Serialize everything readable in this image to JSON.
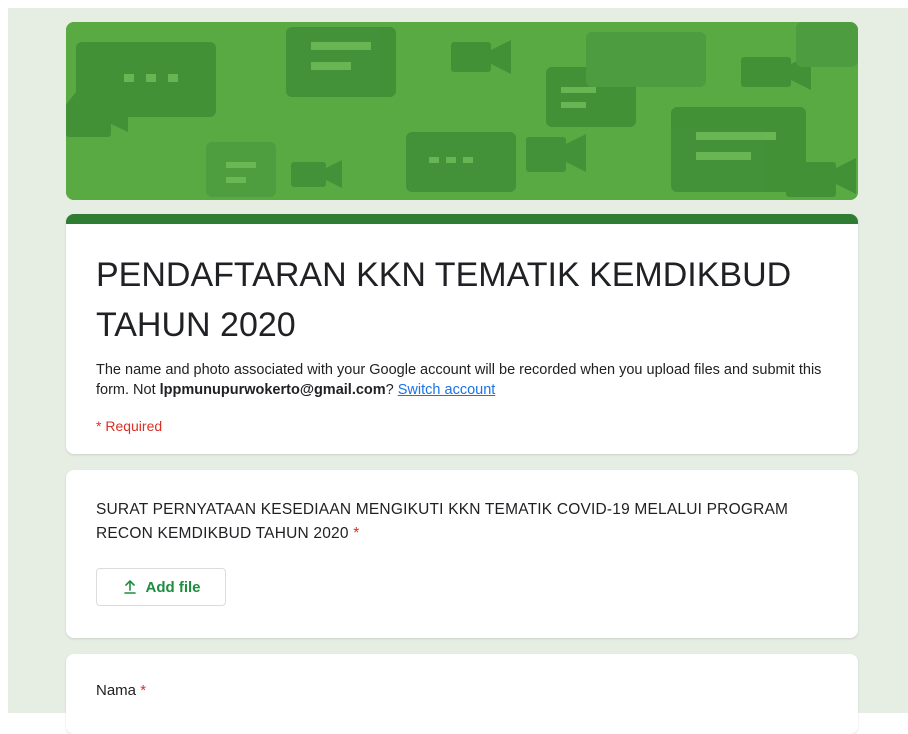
{
  "form": {
    "title": "PENDAFTARAN KKN TEMATIK KEMDIKBUD TAHUN 2020",
    "description_prefix": "The name and photo associated with your Google account will be recorded when you upload files and submit this form. Not ",
    "account_email": "lppmunupurwokerto@gmail.com",
    "description_suffix": "? ",
    "switch_account_label": "Switch account",
    "required_note": "* Required"
  },
  "questions": [
    {
      "title": "SURAT PERNYATAAN KESEDIAAN MENGIKUTI KKN TEMATIK COVID-19 MELALUI PROGRAM RECON KEMDIKBUD TAHUN 2020",
      "required_mark": "*",
      "add_file_label": "Add file",
      "icon": "upload-icon"
    },
    {
      "title": "Nama",
      "required_mark": "*"
    }
  ],
  "colors": {
    "header_accent": "#2f7d32",
    "banner": "#5aaa44",
    "page_background": "#e6ede3",
    "required": "#d93025",
    "link": "#1a73e8",
    "button_text": "#1e8e3e"
  }
}
